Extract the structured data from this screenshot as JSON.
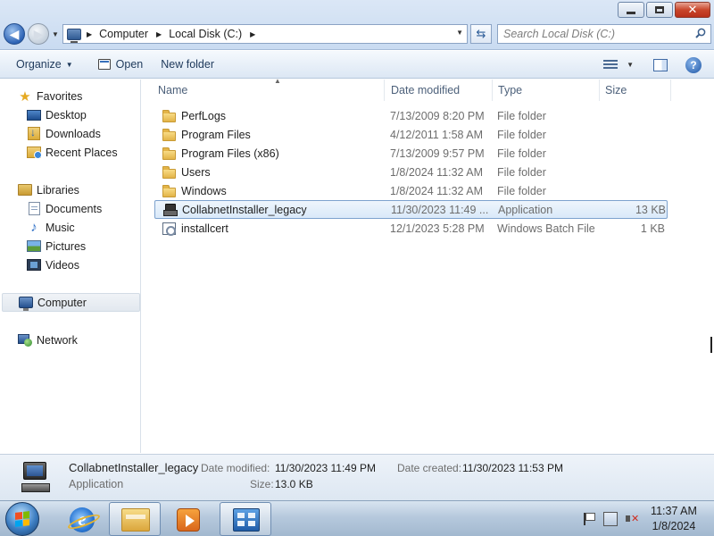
{
  "window": {
    "minimize_glyph": "",
    "close_glyph": "✕"
  },
  "address_bar": {
    "crumbs": [
      "Computer",
      "Local Disk (C:)"
    ],
    "search_placeholder": "Search Local Disk (C:)"
  },
  "command_bar": {
    "organize": "Organize",
    "open": "Open",
    "new_folder": "New folder"
  },
  "nav_pane": {
    "favorites": {
      "label": "Favorites",
      "items": [
        "Desktop",
        "Downloads",
        "Recent Places"
      ]
    },
    "libraries": {
      "label": "Libraries",
      "items": [
        "Documents",
        "Music",
        "Pictures",
        "Videos"
      ]
    },
    "computer": "Computer",
    "network": "Network",
    "selected": "Computer"
  },
  "columns": {
    "name": "Name",
    "date_modified": "Date modified",
    "type": "Type",
    "size": "Size"
  },
  "files": [
    {
      "name": "PerfLogs",
      "date": "7/13/2009 8:20 PM",
      "type": "File folder",
      "size": "",
      "icon": "folder-icon"
    },
    {
      "name": "Program Files",
      "date": "4/12/2011 1:58 AM",
      "type": "File folder",
      "size": "",
      "icon": "folder-icon"
    },
    {
      "name": "Program Files (x86)",
      "date": "7/13/2009 9:57 PM",
      "type": "File folder",
      "size": "",
      "icon": "folder-icon"
    },
    {
      "name": "Users",
      "date": "1/8/2024 11:32 AM",
      "type": "File folder",
      "size": "",
      "icon": "folder-icon"
    },
    {
      "name": "Windows",
      "date": "1/8/2024 11:32 AM",
      "type": "File folder",
      "size": "",
      "icon": "folder-icon"
    },
    {
      "name": "CollabnetInstaller_legacy",
      "date": "11/30/2023 11:49 ...",
      "type": "Application",
      "size": "13 KB",
      "icon": "application-icon",
      "selected": true
    },
    {
      "name": "installcert",
      "date": "12/1/2023 5:28 PM",
      "type": "Windows Batch File",
      "size": "1 KB",
      "icon": "batch-file-icon"
    }
  ],
  "details": {
    "name": "CollabnetInstaller_legacy",
    "type": "Application",
    "date_modified_label": "Date modified:",
    "date_modified": "11/30/2023 11:49 PM",
    "date_created_label": "Date created:",
    "date_created": "11/30/2023 11:53 PM",
    "size_label": "Size:",
    "size": "13.0 KB"
  },
  "taskbar": {
    "time": "11:37 AM",
    "date": "1/8/2024"
  },
  "colors": {
    "selection_border": "#7da2ce",
    "accent": "#1e395b"
  }
}
